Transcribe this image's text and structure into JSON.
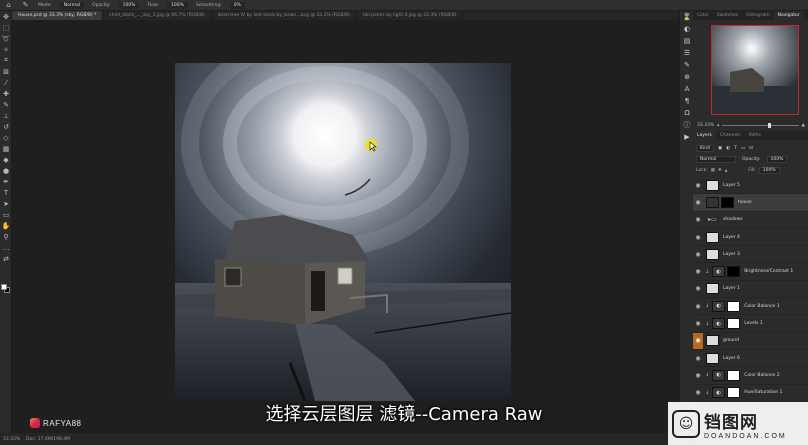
{
  "options_bar": {
    "mode_label": "Mode:",
    "mode_value": "Normal",
    "opacity_label": "Opacity:",
    "opacity_value": "100%",
    "flow_label": "Flow:",
    "flow_value": "100%",
    "smoothing_label": "Smoothing:",
    "smoothing_value": "0%"
  },
  "tabs": [
    "House.psd @ 33.3% (sky, RGB/8) *",
    "child_stock_..._sky_1.jpg @ 66.7% (RGB/8)",
    "dead tree IV by lost stock by jaswe...png @ 33.3% (RGB/8)",
    "tall palms by light 4.jpg @ 33.3% (RGB/8)"
  ],
  "status": {
    "zoom": "33.33%",
    "doc": "Doc: 17.6M/198.4M"
  },
  "watermark": {
    "handle": "RAFYA88",
    "subtitle": "选择云层图层 滤镜--Camera Raw",
    "site_cn": "铛图网",
    "site_en": "DOANDOAN.COM"
  },
  "panel_tabs": [
    "Color",
    "Swatches",
    "Histogram",
    "Navigator"
  ],
  "navigator": {
    "zoom": "33.33%"
  },
  "layers_panel": {
    "tabs": [
      "Layers",
      "Channels",
      "Paths"
    ],
    "filter_label": "Kind",
    "blend_mode": "Normal",
    "opacity_label": "Opacity:",
    "opacity_value": "100%",
    "lock_label": "Lock:",
    "fill_label": "Fill:",
    "fill_value": "100%",
    "layers": [
      {
        "name": "Layer 5",
        "thumb": "light",
        "mask": false,
        "selected": false,
        "eye": "normal"
      },
      {
        "name": "house",
        "thumb": "dark",
        "mask": true,
        "mask_color": "black",
        "selected": true,
        "eye": "normal"
      },
      {
        "name": "shadows",
        "thumb": "folder",
        "mask": false,
        "selected": false,
        "eye": "normal"
      },
      {
        "name": "Layer 4",
        "thumb": "light",
        "mask": false,
        "selected": false,
        "eye": "normal"
      },
      {
        "name": "Layer 3",
        "thumb": "light",
        "mask": false,
        "selected": false,
        "eye": "normal"
      },
      {
        "name": "Brightness/Contrast 1",
        "thumb": "adj",
        "mask": true,
        "mask_color": "black",
        "selected": false,
        "eye": "normal"
      },
      {
        "name": "Layer 1",
        "thumb": "light",
        "mask": false,
        "selected": false,
        "eye": "normal"
      },
      {
        "name": "Color Balance 1",
        "thumb": "adj",
        "mask": true,
        "mask_color": "white",
        "selected": false,
        "eye": "normal"
      },
      {
        "name": "Levels 1",
        "thumb": "adj",
        "mask": true,
        "mask_color": "white",
        "selected": false,
        "eye": "normal"
      },
      {
        "name": "ground",
        "thumb": "light",
        "mask": false,
        "selected": false,
        "eye": "orange"
      },
      {
        "name": "Layer 6",
        "thumb": "light",
        "mask": false,
        "selected": false,
        "eye": "normal"
      },
      {
        "name": "Color Balance 2",
        "thumb": "adj",
        "mask": true,
        "mask_color": "white",
        "selected": false,
        "eye": "normal"
      },
      {
        "name": "Hue/Saturation 1",
        "thumb": "adj",
        "mask": true,
        "mask_color": "white",
        "selected": false,
        "eye": "normal"
      }
    ]
  }
}
